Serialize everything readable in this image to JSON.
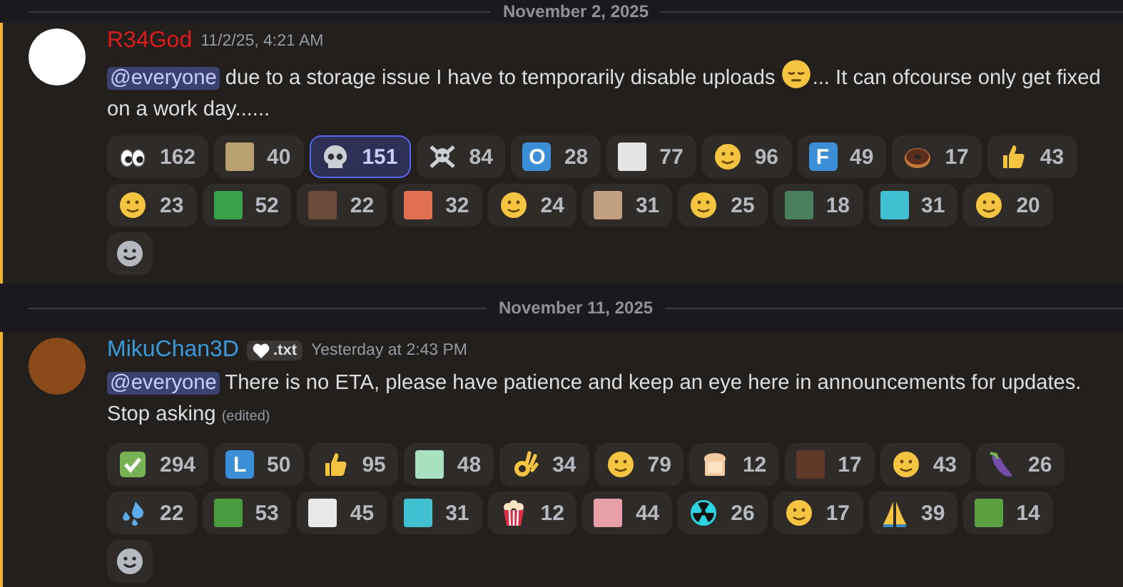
{
  "dividers": [
    {
      "label": "November 2, 2025"
    },
    {
      "label": "November 11, 2025"
    }
  ],
  "messages": [
    {
      "author": "R34God",
      "timestamp": "11/2/25, 4:21 AM",
      "content": [
        {
          "kind": "mention",
          "text": "@everyone"
        },
        {
          "kind": "text",
          "text": " due to a storage issue I have to temporarily disable uploads "
        },
        {
          "kind": "emoji"
        },
        {
          "kind": "text",
          "text": "... It can ofcourse only get fixed on a work day......"
        }
      ],
      "reactions": [
        {
          "kind": "eyes",
          "count": "162",
          "selected": false
        },
        {
          "kind": "picture",
          "color": "#b8a070",
          "count": "40",
          "selected": false
        },
        {
          "kind": "skull",
          "count": "151",
          "selected": true
        },
        {
          "kind": "crossbones",
          "count": "84",
          "selected": false
        },
        {
          "kind": "letter",
          "letter": "O",
          "color": "#3b8fd6",
          "count": "28",
          "selected": false
        },
        {
          "kind": "picture",
          "color": "#e4e4e4",
          "count": "77",
          "selected": false
        },
        {
          "kind": "face",
          "count": "96",
          "selected": false
        },
        {
          "kind": "letter",
          "letter": "F",
          "color": "#3b8fd6",
          "count": "49",
          "selected": false
        },
        {
          "kind": "donut",
          "count": "17",
          "selected": false
        },
        {
          "kind": "thumb",
          "count": "43",
          "selected": false
        },
        {
          "kind": "face",
          "count": "23",
          "selected": false
        },
        {
          "kind": "picture",
          "color": "#3aa14a",
          "count": "52",
          "selected": false
        },
        {
          "kind": "picture",
          "color": "#6b4a3a",
          "count": "22",
          "selected": false
        },
        {
          "kind": "picture",
          "color": "#e07050",
          "count": "32",
          "selected": false
        },
        {
          "kind": "face",
          "count": "24",
          "selected": false
        },
        {
          "kind": "picture",
          "color": "#c0a080",
          "count": "31",
          "selected": false
        },
        {
          "kind": "face",
          "count": "25",
          "selected": false
        },
        {
          "kind": "picture",
          "color": "#4a8060",
          "count": "18",
          "selected": false
        },
        {
          "kind": "picture",
          "color": "#40c0d0",
          "count": "31",
          "selected": false
        },
        {
          "kind": "face",
          "count": "20",
          "selected": false
        }
      ]
    },
    {
      "author": "MikuChan3D",
      "tag": ".txt",
      "timestamp": "Yesterday at 2:43 PM",
      "content": [
        {
          "kind": "mention",
          "text": "@everyone"
        },
        {
          "kind": "text",
          "text": " There is no ETA, please have patience and keep an eye here in announcements for updates. Stop asking "
        },
        {
          "kind": "edited",
          "text": "(edited)"
        }
      ],
      "reactions": [
        {
          "kind": "check",
          "count": "294",
          "selected": false
        },
        {
          "kind": "letter",
          "letter": "L",
          "color": "#3b8fd6",
          "count": "50",
          "selected": false
        },
        {
          "kind": "thumb",
          "count": "95",
          "selected": false
        },
        {
          "kind": "picture",
          "color": "#a8e0c0",
          "count": "48",
          "selected": false
        },
        {
          "kind": "okhand",
          "count": "34",
          "selected": false
        },
        {
          "kind": "face",
          "count": "79",
          "selected": false
        },
        {
          "kind": "bread",
          "count": "12",
          "selected": false
        },
        {
          "kind": "picture",
          "color": "#603828",
          "count": "17",
          "selected": false
        },
        {
          "kind": "face",
          "count": "43",
          "selected": false
        },
        {
          "kind": "eggplant",
          "count": "26",
          "selected": false
        },
        {
          "kind": "drops",
          "count": "22",
          "selected": false
        },
        {
          "kind": "picture",
          "color": "#4a9a40",
          "count": "53",
          "selected": false
        },
        {
          "kind": "picture",
          "color": "#e8e8e8",
          "count": "45",
          "selected": false
        },
        {
          "kind": "picture",
          "color": "#40c0d0",
          "count": "31",
          "selected": false
        },
        {
          "kind": "popcorn",
          "count": "12",
          "selected": false
        },
        {
          "kind": "picture",
          "color": "#e8a0a8",
          "count": "44",
          "selected": false
        },
        {
          "kind": "radioactive",
          "count": "26",
          "selected": false
        },
        {
          "kind": "face",
          "count": "17",
          "selected": false
        },
        {
          "kind": "prayer",
          "count": "39",
          "selected": false
        },
        {
          "kind": "picture",
          "color": "#5aa040",
          "count": "14",
          "selected": false
        }
      ]
    }
  ]
}
